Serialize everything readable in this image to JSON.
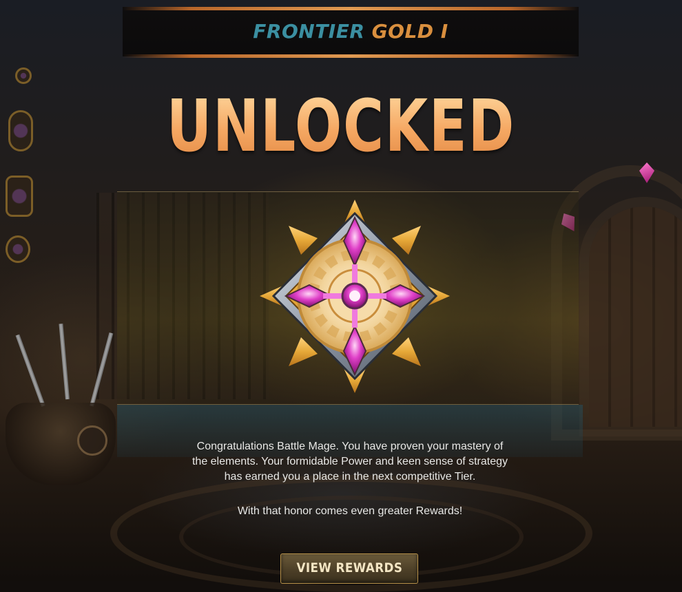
{
  "header": {
    "title_part1": "FRONTIER",
    "title_part2": "GOLD I",
    "title_part1_color": "#3b8fa1",
    "title_part2_color": "#d98f3e"
  },
  "headline": "UNLOCKED",
  "badge": {
    "icon": "gold-tier-badge-icon",
    "gem_color": "#e040c8"
  },
  "message": {
    "line1": "Congratulations Battle Mage. You have proven your mastery of",
    "line2": "the elements. Your formidable Power and keen sense of strategy",
    "line3": "has earned you a place in the next competitive Tier.",
    "line4": "With that honor comes even greater Rewards!"
  },
  "buttons": {
    "view_rewards": "VIEW REWARDS"
  }
}
